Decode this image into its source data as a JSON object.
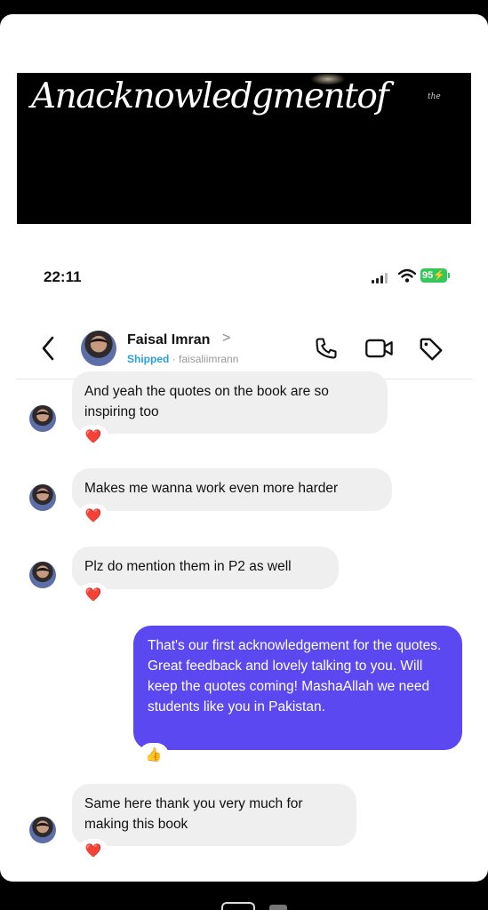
{
  "banner": {
    "title": "Anacknowledgmentof",
    "small_text": "the"
  },
  "status_bar": {
    "time": "22:11",
    "battery": "95"
  },
  "header": {
    "name": "Faisal Imran",
    "chevron": ">",
    "status": "Shipped",
    "separator": "·",
    "username": "faisaliimrann"
  },
  "messages": [
    {
      "sender": "them",
      "text": "And yeah the quotes on the book are so inspiring too",
      "reaction": "❤️"
    },
    {
      "sender": "them",
      "text": "Makes me wanna work even more harder",
      "reaction": "❤️"
    },
    {
      "sender": "them",
      "text": "Plz do mention them in P2 as well",
      "reaction": "❤️"
    },
    {
      "sender": "me",
      "text": "That's our first acknowledgement for the quotes. Great feedback and lovely talking to you. Will keep the quotes coming! MashaAllah we need students like you in Pakistan.",
      "reaction": "👍"
    },
    {
      "sender": "them",
      "text": "Same here thank you very much for making this book",
      "reaction": "❤️"
    }
  ],
  "colors": {
    "my_bubble": "#5b48f0",
    "their_bubble": "#efefef",
    "shipped": "#2a9fd6",
    "battery": "#34c759"
  },
  "icons": [
    "back-chevron-icon",
    "phone-icon",
    "video-icon",
    "tag-icon",
    "heart-icon",
    "thumbs-up-icon"
  ]
}
